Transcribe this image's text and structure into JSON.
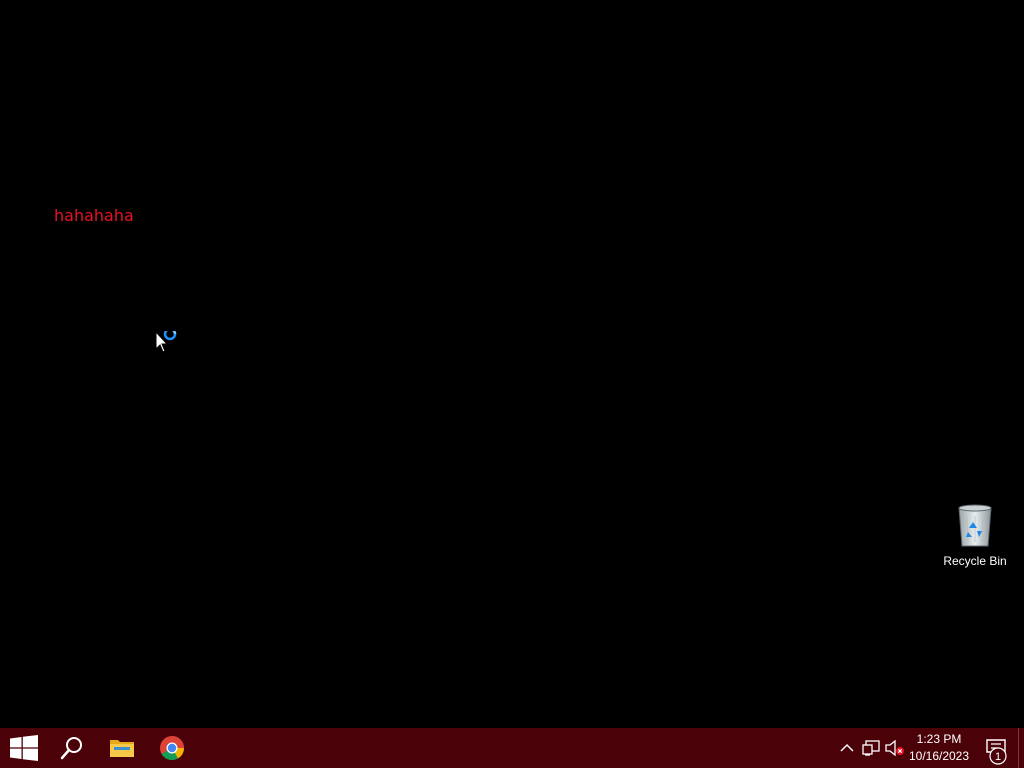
{
  "desktop": {
    "text": "hahahaha",
    "text_color": "#e81123",
    "background": "#000000",
    "icons": [
      {
        "label": "Recycle Bin",
        "icon": "recycle-bin-icon"
      }
    ]
  },
  "taskbar": {
    "background": "#4a0208",
    "pinned": [
      {
        "name": "start",
        "icon": "windows-logo-icon"
      },
      {
        "name": "search",
        "icon": "search-icon"
      },
      {
        "name": "file-explorer",
        "icon": "folder-icon"
      },
      {
        "name": "chrome",
        "icon": "chrome-icon"
      }
    ],
    "tray": {
      "icons": [
        "chevron-up-icon",
        "network-icon",
        "volume-muted-icon"
      ],
      "time": "1:23 PM",
      "date": "10/16/2023",
      "notification_count": "1"
    }
  },
  "cursor": {
    "state": "busy"
  }
}
